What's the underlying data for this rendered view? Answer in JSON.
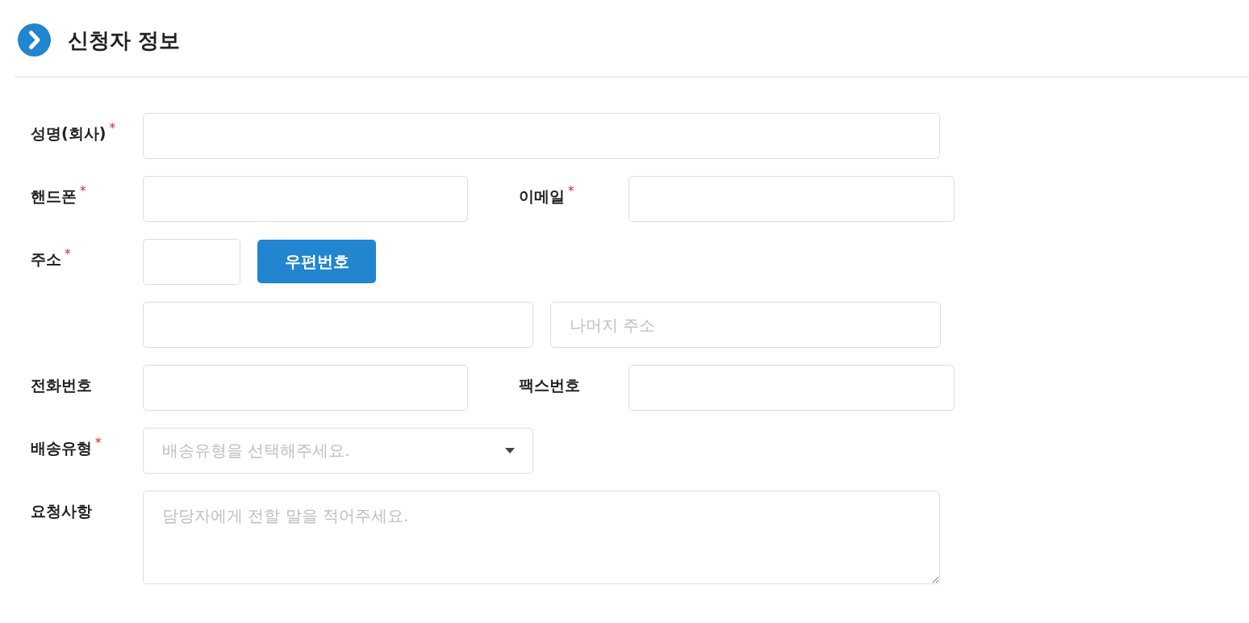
{
  "section": {
    "title": "신청자 정보"
  },
  "rows": [
    {
      "kind": "wide",
      "fields": [
        {
          "kind": "text",
          "label": "성명(회사)",
          "mark": "*"
        }
      ]
    },
    {
      "kind": "pair",
      "fields": [
        {
          "kind": "text",
          "label": "핸드폰",
          "mark": "*"
        },
        {
          "kind": "text",
          "label": "이메일",
          "mark": "*"
        }
      ]
    },
    {
      "kind": "wide",
      "fields": [
        {
          "kind": "zip",
          "label": "주소",
          "mark": "*",
          "button": "우편번호"
        }
      ]
    },
    {
      "kind": "split",
      "fields": [
        {
          "kind": "text"
        },
        {
          "kind": "text",
          "placeholder": "나머지 주소"
        }
      ]
    },
    {
      "kind": "pair",
      "fields": [
        {
          "kind": "text",
          "label": "전화번호"
        },
        {
          "kind": "text",
          "label": "팩스번호"
        }
      ]
    },
    {
      "kind": "wide",
      "fields": [
        {
          "kind": "select",
          "label": "배송유형",
          "mark": "*",
          "placeholder": "배송유형을 선택해주세요."
        }
      ]
    },
    {
      "kind": "wide",
      "fields": [
        {
          "kind": "textarea",
          "label": "요청사항",
          "placeholder": "담당자에게 전할 말을 적어주세요."
        }
      ]
    }
  ]
}
